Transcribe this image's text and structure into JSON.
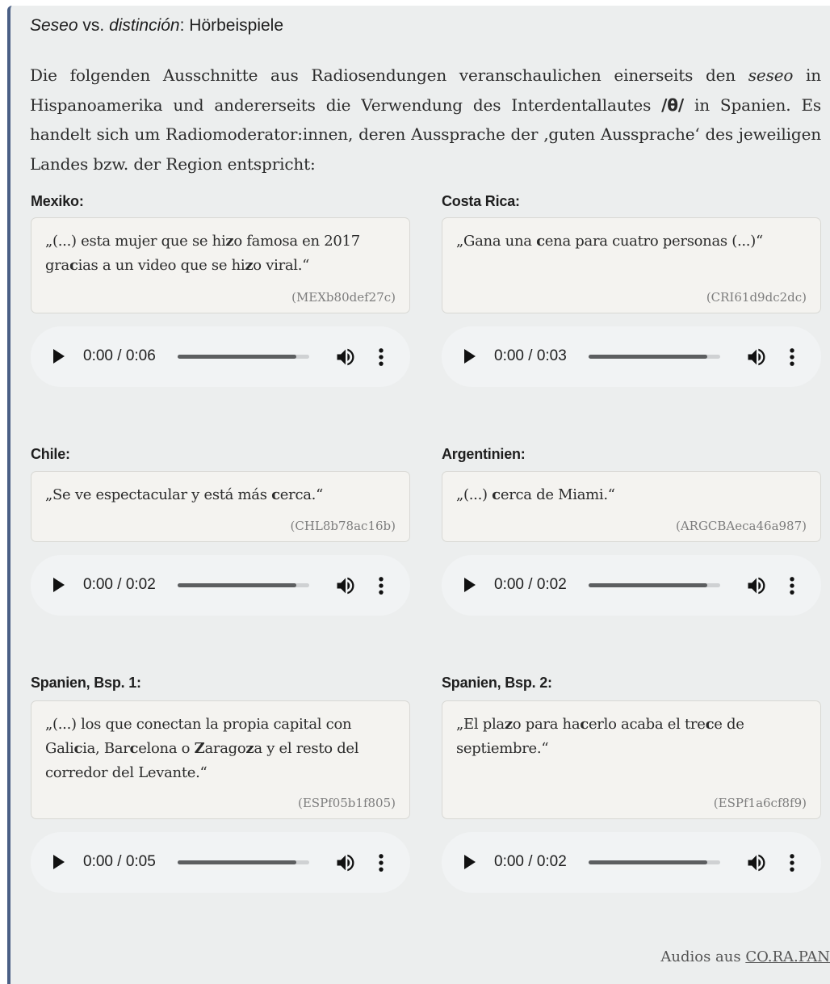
{
  "title": {
    "part1": "Seseo",
    "part2": " vs. ",
    "part3": "distinción",
    "part4": ": Hörbeispiele"
  },
  "intro": {
    "t1": "Die folgenden Ausschnitte aus Radiosendungen veranschaulichen einerseits den ",
    "seseo": "seseo",
    "t2": " in Hispanoamerika und andererseits die Verwendung des Interdentallautes ",
    "phoneme": "/θ/",
    "t3": " in Spanien. Es handelt sich um Radiomoderator:innen, deren Aussprache der ‚guten Aussprache‘ des jeweiligen Landes bzw. der Region entspricht:"
  },
  "examples": [
    {
      "label": "Mexiko:",
      "id": "(MEXb80def27c)",
      "time": "0:00 / 0:06"
    },
    {
      "label": "Costa Rica:",
      "id": "(CRI61d9dc2dc)",
      "time": "0:00 / 0:03"
    },
    {
      "label": "Chile:",
      "id": "(CHL8b78ac16b)",
      "time": "0:00 / 0:02"
    },
    {
      "label": "Argentinien:",
      "id": "(ARGCBAeca46a987)",
      "time": "0:00 / 0:02"
    },
    {
      "label": "Spanien, Bsp. 1:",
      "id": "(ESPf05b1f805)",
      "time": "0:00 / 0:05"
    },
    {
      "label": "Spanien, Bsp. 2:",
      "id": "(ESPf1a6cf8f9)",
      "time": "0:00 / 0:02"
    }
  ],
  "quotes": {
    "mex": [
      "„(...) esta mujer que se hi",
      "z",
      "o famosa en 2017 gra",
      "c",
      "ias a un video que se hi",
      "z",
      "o viral.“"
    ],
    "cri": [
      "„Gana una ",
      "c",
      "ena para cuatro personas (...)“"
    ],
    "chl": [
      "„Se ve espectacular y está más ",
      "c",
      "erca.“"
    ],
    "arg": [
      "„(...) ",
      "c",
      "erca de Miami.“"
    ],
    "esp1": [
      "„(...) los que conectan la propia capital con Gali",
      "c",
      "ia, Bar",
      "c",
      "elona o ",
      "Z",
      "arago",
      "z",
      "a y el resto del corredor del Levante.“"
    ],
    "esp2": [
      "„El pla",
      "z",
      "o para ha",
      "c",
      "erlo acaba el tre",
      "c",
      "e de septiembre.“"
    ]
  },
  "player": {
    "progress": 0.9
  },
  "footer": {
    "prefix": "Audios aus ",
    "link": "CO.RA.PAN"
  },
  "colors": {
    "accent_border": "#4a5f85",
    "card_bg": "#eceeee",
    "quote_bg": "#f4f3f0",
    "player_bg": "#f1f3f4"
  }
}
